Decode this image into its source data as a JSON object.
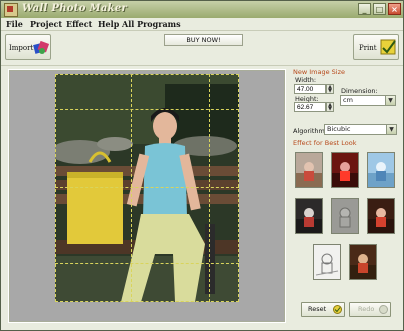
{
  "window": {
    "title": "Wall Photo Maker",
    "controls": [
      "_",
      "□",
      "×"
    ]
  },
  "menu": [
    {
      "label": "File",
      "accel": "F"
    },
    {
      "label": "Project",
      "accel": "P"
    },
    {
      "label": "Effect",
      "accel": "E"
    },
    {
      "label": "Help",
      "accel": "H"
    },
    {
      "label": "All Programs",
      "accel": "A"
    }
  ],
  "toolbar": {
    "import_label": "Import",
    "buy_label": "BUY NOW!",
    "print_label": "Print"
  },
  "size_panel": {
    "heading": "New Image Size",
    "width_label": "Width:",
    "width_value": "47.00",
    "height_label": "Height:",
    "height_value": "62.67",
    "dimension_label": "Dimension:",
    "dimension_value": "cm"
  },
  "algorithm": {
    "label": "Algorithm:",
    "value": "Bicubic"
  },
  "effects": {
    "heading": "Effect for Best Look",
    "thumbnails": [
      {
        "name": "effect-thumb-normal",
        "tone": "normal"
      },
      {
        "name": "effect-thumb-red",
        "tone": "red"
      },
      {
        "name": "effect-thumb-blue",
        "tone": "blue"
      },
      {
        "name": "effect-thumb-dark",
        "tone": "dark"
      },
      {
        "name": "effect-thumb-emboss",
        "tone": "emboss"
      },
      {
        "name": "effect-thumb-warm",
        "tone": "warm"
      },
      {
        "name": "effect-thumb-sketch",
        "tone": "sketch"
      },
      {
        "name": "effect-thumb-sepia",
        "tone": "sepia"
      }
    ]
  },
  "buttons": {
    "reset_label": "Reset",
    "undo_label": "Redo"
  },
  "colors": {
    "accent_orange": "#b7491b",
    "grid_yellow": "#d9d45c",
    "title_bar": "#9aaa6f"
  }
}
